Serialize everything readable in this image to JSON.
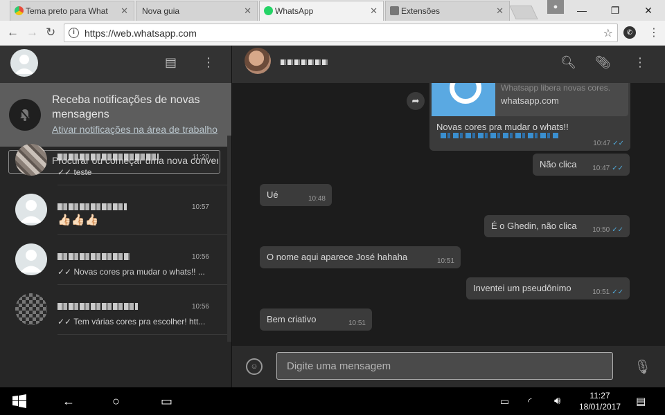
{
  "browser": {
    "tabs": [
      {
        "label": "Tema preto para What",
        "favicon_color": "#e74c3c"
      },
      {
        "label": "Nova guia",
        "favicon_color": ""
      },
      {
        "label": "WhatsApp",
        "favicon_color": "#25d366"
      },
      {
        "label": "Extensões",
        "favicon_color": "#777777"
      }
    ],
    "address": "https://web.whatsapp.com"
  },
  "sidebar": {
    "notification": {
      "title": "Receba notificações de novas mensagens",
      "link": "Ativar notificações na área de trabalho"
    },
    "search_placeholder": "Procurar ou começar uma nova conversa",
    "chats": [
      {
        "time": "11:20",
        "preview": "✓✓ teste"
      },
      {
        "time": "10:57",
        "preview": "👍🏻👍🏻👍🏻"
      },
      {
        "time": "10:56",
        "preview": "✓✓ Novas cores pra mudar o whats!! ..."
      },
      {
        "time": "10:56",
        "preview": "✓✓ Tem várias cores pra escolher! htt..."
      }
    ]
  },
  "conversation": {
    "link_preview": {
      "description": "Whatsapp libera novas cores.",
      "domain": "whatsapp.com"
    },
    "messages": [
      {
        "text": "Novas cores pra mudar o whats!!",
        "time": "10:47",
        "ticks": "✓✓"
      },
      {
        "text": "Não clica",
        "time": "10:47",
        "ticks": "✓✓"
      },
      {
        "text": "Ué",
        "time": "10:48",
        "ticks": ""
      },
      {
        "text": "É o Ghedin, não clica",
        "time": "10:50",
        "ticks": "✓✓"
      },
      {
        "text": "O nome aqui aparece José hahaha",
        "time": "10:51",
        "ticks": ""
      },
      {
        "text": "Inventei um pseudônimo",
        "time": "10:51",
        "ticks": "✓✓"
      },
      {
        "text": "Bem criativo",
        "time": "10:51",
        "ticks": ""
      }
    ],
    "compose_placeholder": "Digite uma mensagem"
  },
  "taskbar": {
    "time": "11:27",
    "date": "18/01/2017"
  },
  "colors": {
    "accent_ticks": "#4fa7d6",
    "bubble_bg": "#3b3b3b",
    "panel_bg": "#262626"
  }
}
